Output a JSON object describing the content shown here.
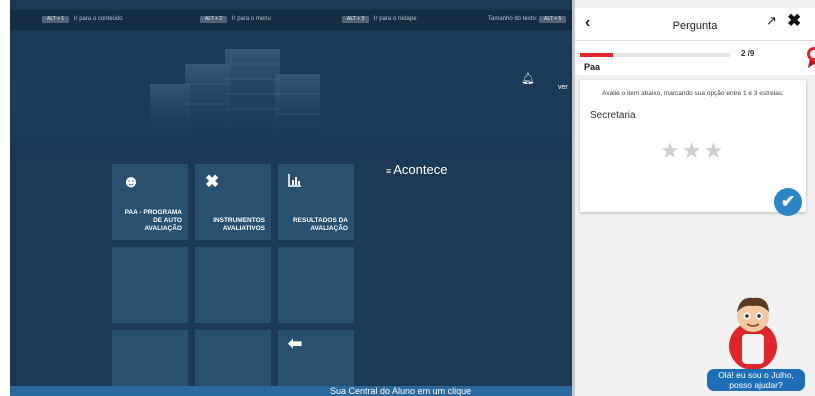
{
  "topbar": {
    "links": [
      {
        "key": "ALT + 1",
        "label": "Ir para o conteúdo"
      },
      {
        "key": "ALT + 2",
        "label": "Ir para o menu"
      },
      {
        "key": "ALT + 3",
        "label": "Ir para o rodape"
      },
      {
        "key": "ALT + 5",
        "label": "Tamanho do texto:"
      }
    ]
  },
  "banner": {
    "ver_label": "ver"
  },
  "acontece": {
    "title": "Acontece"
  },
  "tiles": [
    {
      "label_lines": [
        "PAA - PROGRAMA",
        "DE AUTO",
        "AVALIAÇÃO"
      ],
      "icon": "head-gear-icon"
    },
    {
      "label_lines": [
        "INSTRUMENTOS",
        "AVALIATIVOS"
      ],
      "icon": "tools-icon"
    },
    {
      "label_lines": [
        "RESULTADOS DA",
        "AVALIAÇÃO"
      ],
      "icon": "chart-icon"
    },
    {
      "label_lines": [],
      "icon": ""
    },
    {
      "label_lines": [],
      "icon": ""
    },
    {
      "label_lines": [],
      "icon": ""
    },
    {
      "label_lines": [],
      "icon": ""
    },
    {
      "label_lines": [],
      "icon": ""
    },
    {
      "label_lines": [],
      "icon": "arrow-left-icon"
    }
  ],
  "footer": {
    "text": "Sua Central do Aluno em um clique"
  },
  "panel": {
    "title": "Pergunta",
    "progress": {
      "current": 2,
      "total": 9,
      "text": "2 /9",
      "fraction": 0.22
    },
    "section": "Paa",
    "card": {
      "instruction": "Avalie o item abaixo, marcando sua opção entre 1 e 3 estrelas:",
      "item": "Secretaria",
      "max_stars": 3,
      "selected_stars": 0
    },
    "mascot": {
      "bubble_line1": "Olá! eu sou o Julho,",
      "bubble_line2": "posso ajudar?"
    }
  },
  "colors": {
    "main_bg": "#1c3a55",
    "tile": "#29506f",
    "accent_red": "#e0252b",
    "accent_blue": "#2a86c5"
  }
}
